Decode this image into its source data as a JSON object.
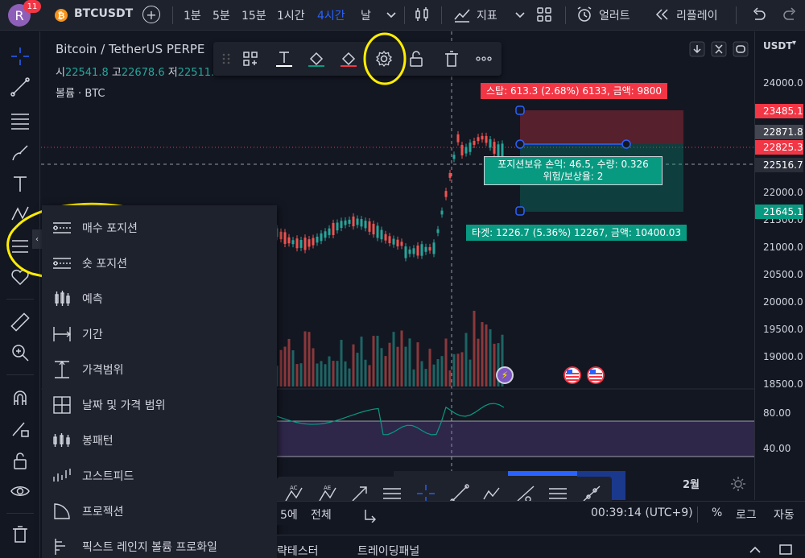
{
  "topbar": {
    "avatar_letter": "R",
    "avatar_badge": "11",
    "coin_glyph": "₿",
    "symbol": "BTCUSDT",
    "timeframes": [
      "1분",
      "5분",
      "15분",
      "1시간",
      "4시간",
      "날"
    ],
    "active_timeframe": "4시간",
    "indicators_label": "지표",
    "alert_label": "얼러트",
    "replay_label": "리플레이"
  },
  "legend": {
    "title": "Bitcoin / TetherUS PERPE",
    "open_label": "시",
    "open_value": "22541.8",
    "high_label": "고",
    "high_value": "22678.6",
    "low_label": "저",
    "low_value": "22511.",
    "volume_label": "볼륨 · BTC"
  },
  "price_axis": {
    "currency": "USDT",
    "labels": [
      "24000.0",
      "22000.0",
      "21500.0",
      "21000.0",
      "20500.0",
      "20000.0",
      "19500.0",
      "19000.0",
      "18500.0"
    ],
    "badges": [
      {
        "text": "23485.1",
        "color": "#f23645"
      },
      {
        "text": "22871.8",
        "color": "#434651"
      },
      {
        "text": "22825.3",
        "color": "#f23645"
      },
      {
        "text": "22516.7",
        "color": "#2a2e39"
      },
      {
        "text": "21645.1",
        "color": "#089981"
      }
    ],
    "osc_labels": [
      "80.00",
      "40.00"
    ]
  },
  "position": {
    "stop": "스탑: 613.3 (2.68%) 6133, 금액: 9800",
    "line1": "포지션보유 손익: 46.5, 수량: 0.326",
    "line2": "위험/보상율: 2",
    "target": "타겟: 1226.7 (5.36%) 12267, 금액: 10400.03"
  },
  "popup": {
    "items": [
      {
        "label": "매수 포지션",
        "icon": "long-position-icon"
      },
      {
        "label": "숏 포지션",
        "icon": "short-position-icon"
      },
      {
        "label": "예측",
        "icon": "forecast-icon"
      },
      {
        "label": "기간",
        "icon": "date-range-icon"
      },
      {
        "label": "가격범위",
        "icon": "price-range-icon"
      },
      {
        "label": "날짜 및 가격 범위",
        "icon": "date-price-range-icon"
      },
      {
        "label": "봉패턴",
        "icon": "bars-pattern-icon"
      },
      {
        "label": "고스트피드",
        "icon": "ghost-feed-icon"
      },
      {
        "label": "프로젝션",
        "icon": "projection-icon"
      },
      {
        "label": "픽스트 레인지 볼륨 프로화일",
        "icon": "fixed-range-volume-icon"
      }
    ]
  },
  "time_axis": {
    "month_label": "2월"
  },
  "statusbar": {
    "range_label": "5에",
    "all_label": "전체",
    "clock": "00:39:14 (UTC+9)",
    "percent": "%",
    "log": "로그",
    "auto": "자동"
  },
  "panelbar": {
    "strategy_tester": "략테스터",
    "trading_panel": "트레이딩패널"
  },
  "colors": {
    "up": "#26a69a",
    "down": "#ef5350",
    "accent": "#2962ff",
    "highlight": "#ffee00"
  }
}
